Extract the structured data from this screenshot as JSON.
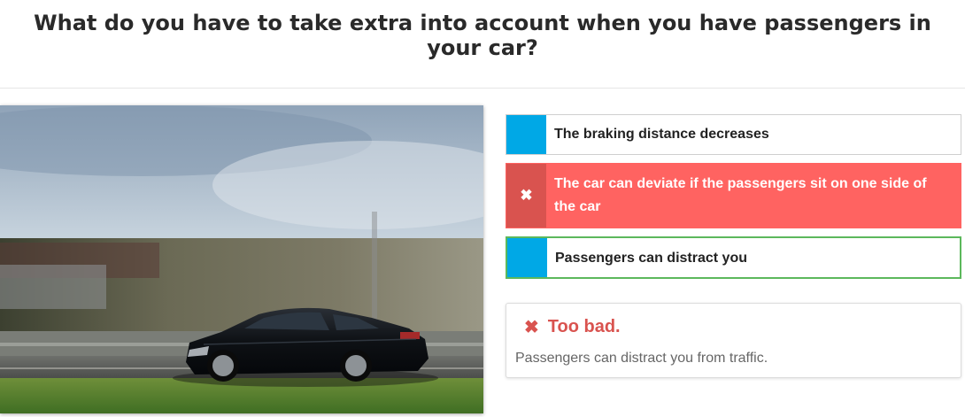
{
  "question": {
    "title": "What do you have to take extra into account when you have passengers in your car?"
  },
  "image": {
    "description_icon": "car-photo-icon"
  },
  "answers": [
    {
      "label": "The braking distance decreases",
      "state": "neutral",
      "marker": ""
    },
    {
      "label": "The car can deviate if the passengers sit on one side of the car",
      "state": "wrong",
      "marker": "✖"
    },
    {
      "label": "Passengers can distract you",
      "state": "correct",
      "marker": ""
    }
  ],
  "feedback": {
    "icon": "✖",
    "title": "Too bad.",
    "message": "Passengers can distract you from traffic."
  },
  "colors": {
    "marker_blue": "#00a8e6",
    "wrong_bg": "#ff6361",
    "wrong_marker": "#d9534f",
    "correct_border": "#5cb85c",
    "feedback_red": "#d9534f"
  }
}
